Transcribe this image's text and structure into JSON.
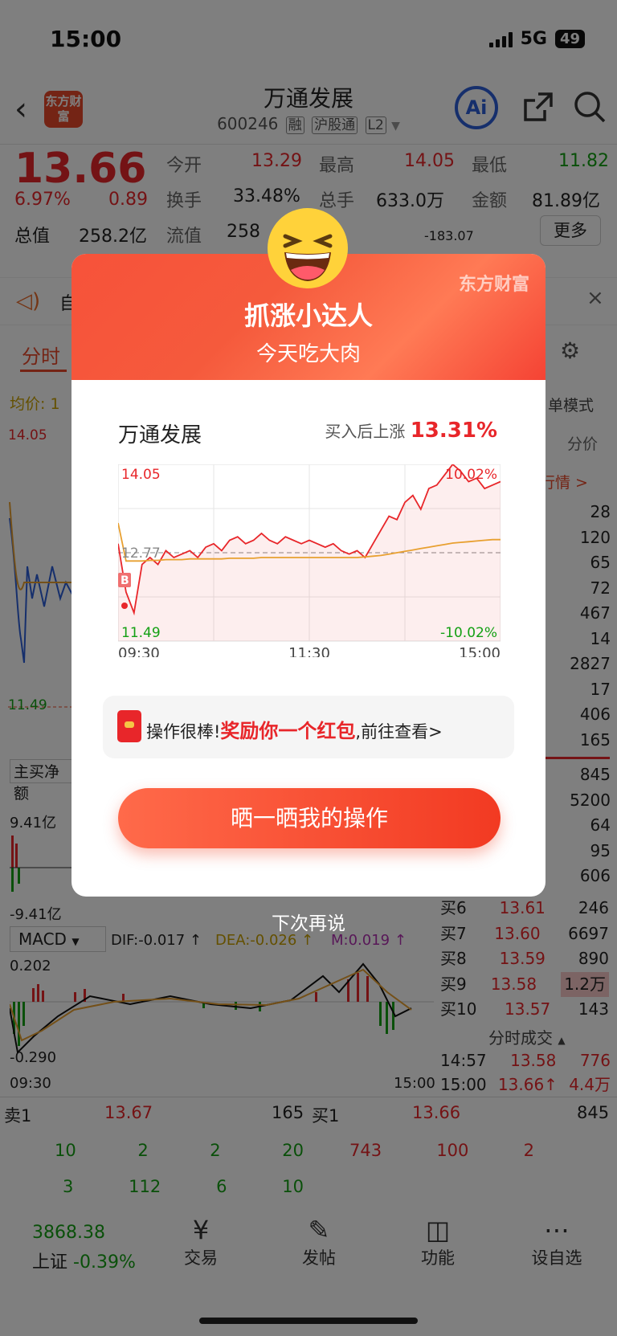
{
  "status": {
    "time": "15:00",
    "network": "5G",
    "battery": "49"
  },
  "header": {
    "title": "万通发展",
    "code": "600246",
    "tags": [
      "融",
      "沪股通",
      "L2"
    ],
    "logo_text": "东方财富",
    "ai_label": "Ai"
  },
  "quote": {
    "price": "13.66",
    "change_pct": "6.97%",
    "change": "0.89",
    "open_label": "今开",
    "open": "13.29",
    "high_label": "最高",
    "high": "14.05",
    "low_label": "最低",
    "low": "11.82",
    "turnover_label": "换手",
    "turnover": "33.48%",
    "volume_label": "总手",
    "volume": "633.0万",
    "amount_label": "金额",
    "amount": "81.89亿",
    "mktcap_label": "总值",
    "mktcap": "258.2亿",
    "float_label": "流值",
    "float": "258",
    "flow_value": "-183.07",
    "more_label": "更多"
  },
  "background": {
    "notice_text": "自",
    "tab_active": "分时",
    "avg_label": "均价: 1",
    "mode_label": "单模式",
    "price_high": "14.05",
    "price_mid": "12.77",
    "price_low": "11.49",
    "fund_label": "主买净额",
    "fund_high": "9.41亿",
    "fund_low": "-9.41亿",
    "macd_label": "MACD",
    "dif": "DIF:-0.017 ↑",
    "dea": "DEA:-0.026 ↑",
    "m": "M:0.019 ↑",
    "macd_high": "0.202",
    "macd_low": "-0.290",
    "time_start": "09:30",
    "time_end": "15:00",
    "right_header": "分价",
    "right_link": "行情 >",
    "right_vols": [
      "28",
      "120",
      "65",
      "72",
      "467",
      "14",
      "2827",
      "17",
      "406",
      "165",
      "845",
      "5200",
      "64",
      "95",
      "606"
    ],
    "bids": [
      {
        "label": "买6",
        "price": "13.61",
        "vol": "246"
      },
      {
        "label": "买7",
        "price": "13.60",
        "vol": "6697"
      },
      {
        "label": "买8",
        "price": "13.59",
        "vol": "890"
      },
      {
        "label": "买9",
        "price": "13.58",
        "vol": "1.2万"
      },
      {
        "label": "买10",
        "price": "13.57",
        "vol": "143"
      }
    ],
    "ticks_label": "分时成交",
    "ticks": [
      {
        "time": "14:57",
        "price": "13.58",
        "vol": "776"
      },
      {
        "time": "15:00",
        "price": "13.66↑",
        "vol": "4.4万"
      }
    ],
    "sell1_label": "卖1",
    "sell1_price": "13.67",
    "sell1_vol": "165",
    "buy1_label": "买1",
    "buy1_price": "13.66",
    "buy1_vol": "845",
    "queue_sell_row1": [
      "10",
      "2",
      "2",
      "20"
    ],
    "queue_sell_row2": [
      "3",
      "112",
      "6",
      "10"
    ],
    "queue_buy_row1": [
      "743",
      "100",
      "2"
    ]
  },
  "popup": {
    "brand": "东方财富",
    "title": "抓涨小达人",
    "subtitle": "今天吃大肉",
    "stock_name": "万通发展",
    "gain_label": "买入后上涨",
    "gain_pct": "13.31%",
    "reward_prefix": "操作很棒!",
    "reward_highlight": "奖励你一个红包",
    "reward_suffix": ",前往查看>",
    "share_button": "晒一晒我的操作",
    "later": "下次再说"
  },
  "chart_data": {
    "type": "line",
    "title": "",
    "x_labels": [
      "09:30",
      "11:30",
      "15:00"
    ],
    "ylim": [
      11.49,
      14.05
    ],
    "y_labels_left": [
      "14.05",
      "12.77",
      "11.49"
    ],
    "y_labels_right": [
      "10.02%",
      "-10.02%"
    ],
    "buy_marker": "B",
    "series": [
      {
        "values": [
          12.9,
          12.2,
          11.9,
          12.6,
          12.7,
          12.6,
          12.8,
          12.7,
          12.75,
          12.8,
          12.7,
          12.85,
          12.9,
          12.8,
          12.95,
          13.0,
          12.9,
          12.95,
          13.05,
          12.95,
          12.9,
          13.0,
          12.95,
          12.9,
          12.95,
          12.9,
          12.85,
          12.9,
          12.8,
          12.75,
          12.8,
          12.7,
          12.9,
          13.1,
          13.3,
          13.25,
          13.5,
          13.6,
          13.4,
          13.7,
          13.75,
          13.9,
          14.05,
          13.95,
          13.8,
          13.85,
          13.7,
          13.75,
          13.8
        ]
      },
      {
        "values": [
          13.2,
          12.65,
          12.65,
          12.65,
          12.66,
          12.66,
          12.67,
          12.67,
          12.67,
          12.68,
          12.68,
          12.68,
          12.68,
          12.68,
          12.69,
          12.69,
          12.69,
          12.69,
          12.7,
          12.7,
          12.7,
          12.7,
          12.7,
          12.7,
          12.7,
          12.7,
          12.7,
          12.7,
          12.7,
          12.7,
          12.7,
          12.71,
          12.72,
          12.73,
          12.75,
          12.77,
          12.79,
          12.81,
          12.83,
          12.85,
          12.87,
          12.89,
          12.91,
          12.92,
          12.93,
          12.94,
          12.95,
          12.96,
          12.96
        ]
      }
    ]
  },
  "bottom_nav": {
    "index_value": "3868.38",
    "index_name": "上证",
    "index_change": "-0.39%",
    "items": [
      "交易",
      "发帖",
      "功能",
      "设自选"
    ]
  }
}
